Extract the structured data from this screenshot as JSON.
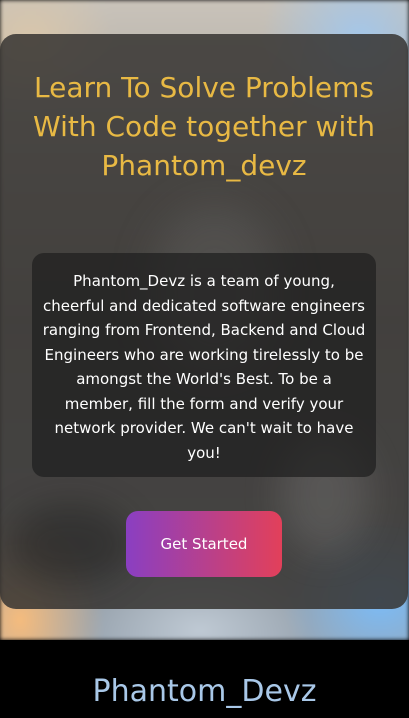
{
  "hero": {
    "headline": "Learn To Solve Problems With Code together with Phantom_devz",
    "description": "Phantom_Devz is a team of young, cheerful and dedicated software engineers ranging from Frontend, Backend and Cloud Engineers who are working tirelessly to be amongst the World's Best. To be a member, fill the form and verify your network provider. We can't wait to have you!",
    "cta_label": "Get Started"
  },
  "footer": {
    "brand": "Phantom_Devz"
  },
  "colors": {
    "headline": "#e8b944",
    "cta_start": "#8a3fc2",
    "cta_end": "#e2405a",
    "brand": "#a9c8e8"
  }
}
